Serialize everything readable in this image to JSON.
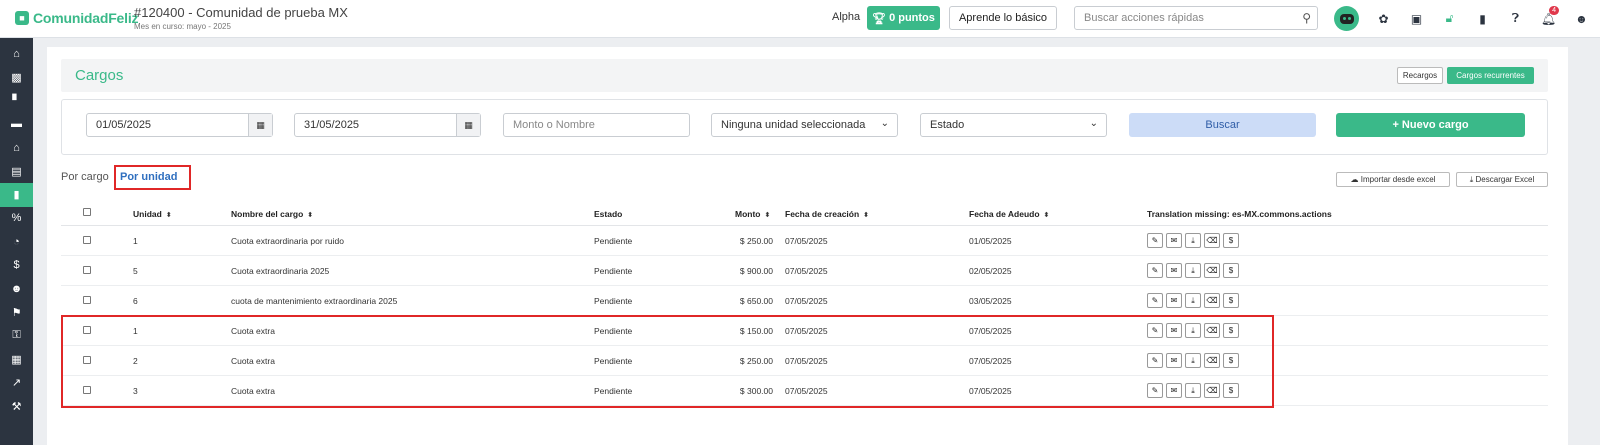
{
  "app": {
    "logo_text": "ComunidadFeliz",
    "community_name": "#120400 - Comunidad de prueba MX",
    "month_label": "Mes en curso: mayo - 2025",
    "alpha_label": "Alpha",
    "points_label": "0 puntos",
    "learn_label": "Aprende lo básico",
    "search_placeholder": "Buscar acciones rápidas",
    "notification_count": "4"
  },
  "sidebar": {
    "icons": [
      "home-icon",
      "money-icon",
      "chart-bar-icon",
      "card-icon",
      "bank-icon",
      "document-icon",
      "book-icon",
      "percent-icon",
      "gauge-icon",
      "dollar-icon",
      "users-icon",
      "flag-icon",
      "key-icon",
      "calculator-icon",
      "line-chart-icon",
      "wrench-icon"
    ],
    "active_index": 6
  },
  "page": {
    "title": "Cargos",
    "recargos_label": "Recargos",
    "recurrentes_label": "Cargos recurrentes"
  },
  "filters": {
    "date_from": "01/05/2025",
    "date_to": "31/05/2025",
    "amount_name_placeholder": "Monto o Nombre",
    "unit_select": "Ninguna unidad seleccionada",
    "estado_select": "Estado",
    "buscar_label": "Buscar",
    "nuevo_label": "+ Nuevo cargo"
  },
  "tabs": {
    "por_cargo": "Por cargo",
    "por_unidad": "Por unidad"
  },
  "exports": {
    "import_label": "Importar desde excel",
    "download_label": "Descargar Excel"
  },
  "table": {
    "headers": {
      "unidad": "Unidad",
      "nombre": "Nombre del cargo",
      "estado": "Estado",
      "monto": "Monto",
      "creacion": "Fecha de creación",
      "adeudo": "Fecha de Adeudo",
      "actions": "Translation missing: es-MX.commons.actions"
    },
    "rows": [
      {
        "unidad": "1",
        "nombre": "Cuota extraordinaria por ruido",
        "estado": "Pendiente",
        "monto": "$ 250.00",
        "creacion": "07/05/2025",
        "adeudo": "01/05/2025"
      },
      {
        "unidad": "5",
        "nombre": "Cuota extraordinaria 2025",
        "estado": "Pendiente",
        "monto": "$ 900.00",
        "creacion": "07/05/2025",
        "adeudo": "02/05/2025"
      },
      {
        "unidad": "6",
        "nombre": "cuota de mantenimiento extraordinaria 2025",
        "estado": "Pendiente",
        "monto": "$ 650.00",
        "creacion": "07/05/2025",
        "adeudo": "03/05/2025"
      },
      {
        "unidad": "1",
        "nombre": "Cuota extra",
        "estado": "Pendiente",
        "monto": "$ 150.00",
        "creacion": "07/05/2025",
        "adeudo": "07/05/2025"
      },
      {
        "unidad": "2",
        "nombre": "Cuota extra",
        "estado": "Pendiente",
        "monto": "$ 250.00",
        "creacion": "07/05/2025",
        "adeudo": "07/05/2025"
      },
      {
        "unidad": "3",
        "nombre": "Cuota extra",
        "estado": "Pendiente",
        "monto": "$ 300.00",
        "creacion": "07/05/2025",
        "adeudo": "07/05/2025"
      }
    ]
  },
  "colors": {
    "brand": "#3ab989",
    "sidebar": "#2c3440",
    "highlight": "#e02727"
  }
}
